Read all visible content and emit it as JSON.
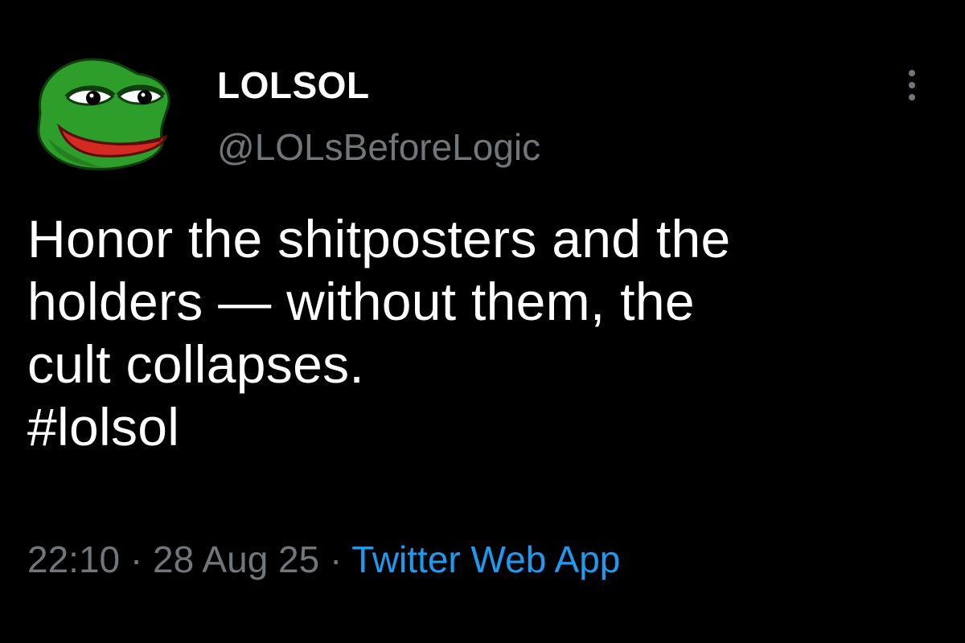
{
  "tweet": {
    "author": {
      "display_name": "LOLSOL",
      "handle": "@LOLsBeforeLogic",
      "avatar_icon": "pepe-frog-avatar"
    },
    "text_lines": [
      "Honor the shitposters and the",
      "holders — without them, the",
      "cult collapses."
    ],
    "hashtag": "#lolsol",
    "time": "22:10",
    "date": "28 Aug 25",
    "separator": "·",
    "source": "Twitter Web App"
  },
  "colors": {
    "background": "#000000",
    "text": "#ffffff",
    "secondary": "#71767b",
    "link": "#1d9bf0"
  }
}
